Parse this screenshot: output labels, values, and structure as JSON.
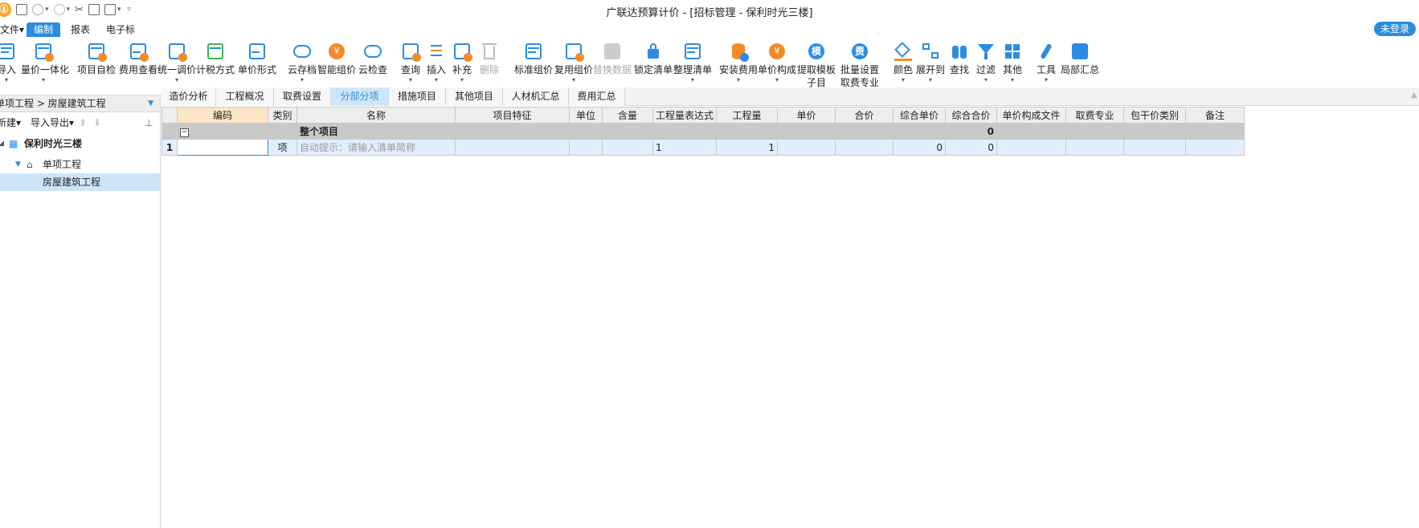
{
  "window": {
    "title": "广联达预算计价 - [招标管理 - 保利时光三楼]"
  },
  "menu": {
    "items": [
      {
        "label": "文件▾"
      },
      {
        "label": "编制"
      },
      {
        "label": "报表"
      },
      {
        "label": "电子标"
      }
    ],
    "login": "未登录"
  },
  "ribbon": {
    "buttons": [
      {
        "label": "导入",
        "icon": "import-icon",
        "dd": "▾"
      },
      {
        "label": "量价一体化",
        "icon": "integration-icon",
        "dd": "▾"
      },
      {
        "label": "项目自检",
        "icon": "self-check-icon",
        "dd": ""
      },
      {
        "label": "费用查看",
        "icon": "cost-view-icon",
        "dd": ""
      },
      {
        "label": "统一调价",
        "icon": "price-adjust-icon",
        "dd": "▾"
      },
      {
        "label": "计税方式",
        "icon": "tax-method-icon",
        "dd": ""
      },
      {
        "label": "单价形式",
        "icon": "unit-price-form-icon",
        "dd": ""
      },
      {
        "label": "云存档",
        "icon": "cloud-archive-icon",
        "dd": "▾"
      },
      {
        "label": "智能组价",
        "icon": "smart-pricing-icon",
        "dd": ""
      },
      {
        "label": "云检查",
        "icon": "cloud-check-icon",
        "dd": ""
      },
      {
        "label": "查询",
        "icon": "query-icon",
        "dd": "▾"
      },
      {
        "label": "插入",
        "icon": "insert-icon",
        "dd": "▾"
      },
      {
        "label": "补充",
        "icon": "supplement-icon",
        "dd": "▾"
      },
      {
        "label": "删除",
        "icon": "delete-icon",
        "dd": ""
      },
      {
        "label": "标准组价",
        "icon": "standard-pricing-icon",
        "dd": ""
      },
      {
        "label": "复用组价",
        "icon": "reuse-pricing-icon",
        "dd": "▾"
      },
      {
        "label": "替换数据",
        "icon": "replace-data-icon",
        "dd": ""
      },
      {
        "label": "锁定清单",
        "icon": "lock-icon",
        "dd": ""
      },
      {
        "label": "整理清单",
        "icon": "organize-list-icon",
        "dd": "▾"
      },
      {
        "label": "安装费用",
        "icon": "install-cost-icon",
        "dd": "▾"
      },
      {
        "label": "单价构成",
        "icon": "price-composition-icon",
        "dd": "▾"
      },
      {
        "label": "提取模板",
        "label2": "子目",
        "icon": "template-icon",
        "dd": ""
      },
      {
        "label": "批量设置",
        "label2": "取费专业",
        "icon": "batch-fee-icon",
        "dd": ""
      },
      {
        "label": "颜色",
        "icon": "color-icon",
        "dd": "▾"
      },
      {
        "label": "展开到",
        "icon": "expand-to-icon",
        "dd": "▾"
      },
      {
        "label": "查找",
        "icon": "find-icon",
        "dd": ""
      },
      {
        "label": "过滤",
        "icon": "filter-icon",
        "dd": "▾"
      },
      {
        "label": "其他",
        "icon": "other-icon",
        "dd": "▾"
      },
      {
        "label": "工具",
        "icon": "tools-icon",
        "dd": "▾"
      },
      {
        "label": "局部汇总",
        "icon": "partial-summary-icon",
        "dd": ""
      }
    ]
  },
  "icon_glyphs": {
    "template": "模",
    "fee": "费",
    "yuan": "¥"
  },
  "left": {
    "breadcrumb": "单项工程 > 房屋建筑工程",
    "new_label": "新建▾",
    "import_export_label": "导入导出▾",
    "tree": [
      {
        "label": "保利时光三楼",
        "level": 0
      },
      {
        "label": "单项工程",
        "level": 1
      },
      {
        "label": "房屋建筑工程",
        "level": 2,
        "selected": true
      }
    ]
  },
  "tabs": [
    {
      "label": "造价分析"
    },
    {
      "label": "工程概况"
    },
    {
      "label": "取费设置"
    },
    {
      "label": "分部分项",
      "active": true
    },
    {
      "label": "措施项目"
    },
    {
      "label": "其他项目"
    },
    {
      "label": "人材机汇总"
    },
    {
      "label": "费用汇总"
    }
  ],
  "table": {
    "columns": [
      "",
      "编码",
      "类别",
      "名称",
      "项目特征",
      "单位",
      "含量",
      "工程量表达式",
      "工程量",
      "单价",
      "合价",
      "综合单价",
      "综合合价",
      "单价构成文件",
      "取费专业",
      "包干价类别",
      "备注"
    ],
    "rows": [
      {
        "rn": "",
        "code": "",
        "type": "",
        "name": "整个项目",
        "feature": "",
        "unit": "",
        "content": "",
        "expr": "",
        "qty": "",
        "price": "",
        "total": "",
        "cprice": "",
        "ctotal": "0",
        "file": "",
        "spec": "",
        "pkg": "",
        "note": ""
      },
      {
        "rn": "1",
        "code": "",
        "type": "项",
        "name": "自动提示：请输入清单简称",
        "feature": "",
        "unit": "",
        "content": "",
        "expr": "1",
        "qty": "1",
        "price": "",
        "total": "",
        "cprice": "0",
        "ctotal": "0",
        "file": "",
        "spec": "",
        "pkg": "",
        "note": ""
      }
    ]
  }
}
